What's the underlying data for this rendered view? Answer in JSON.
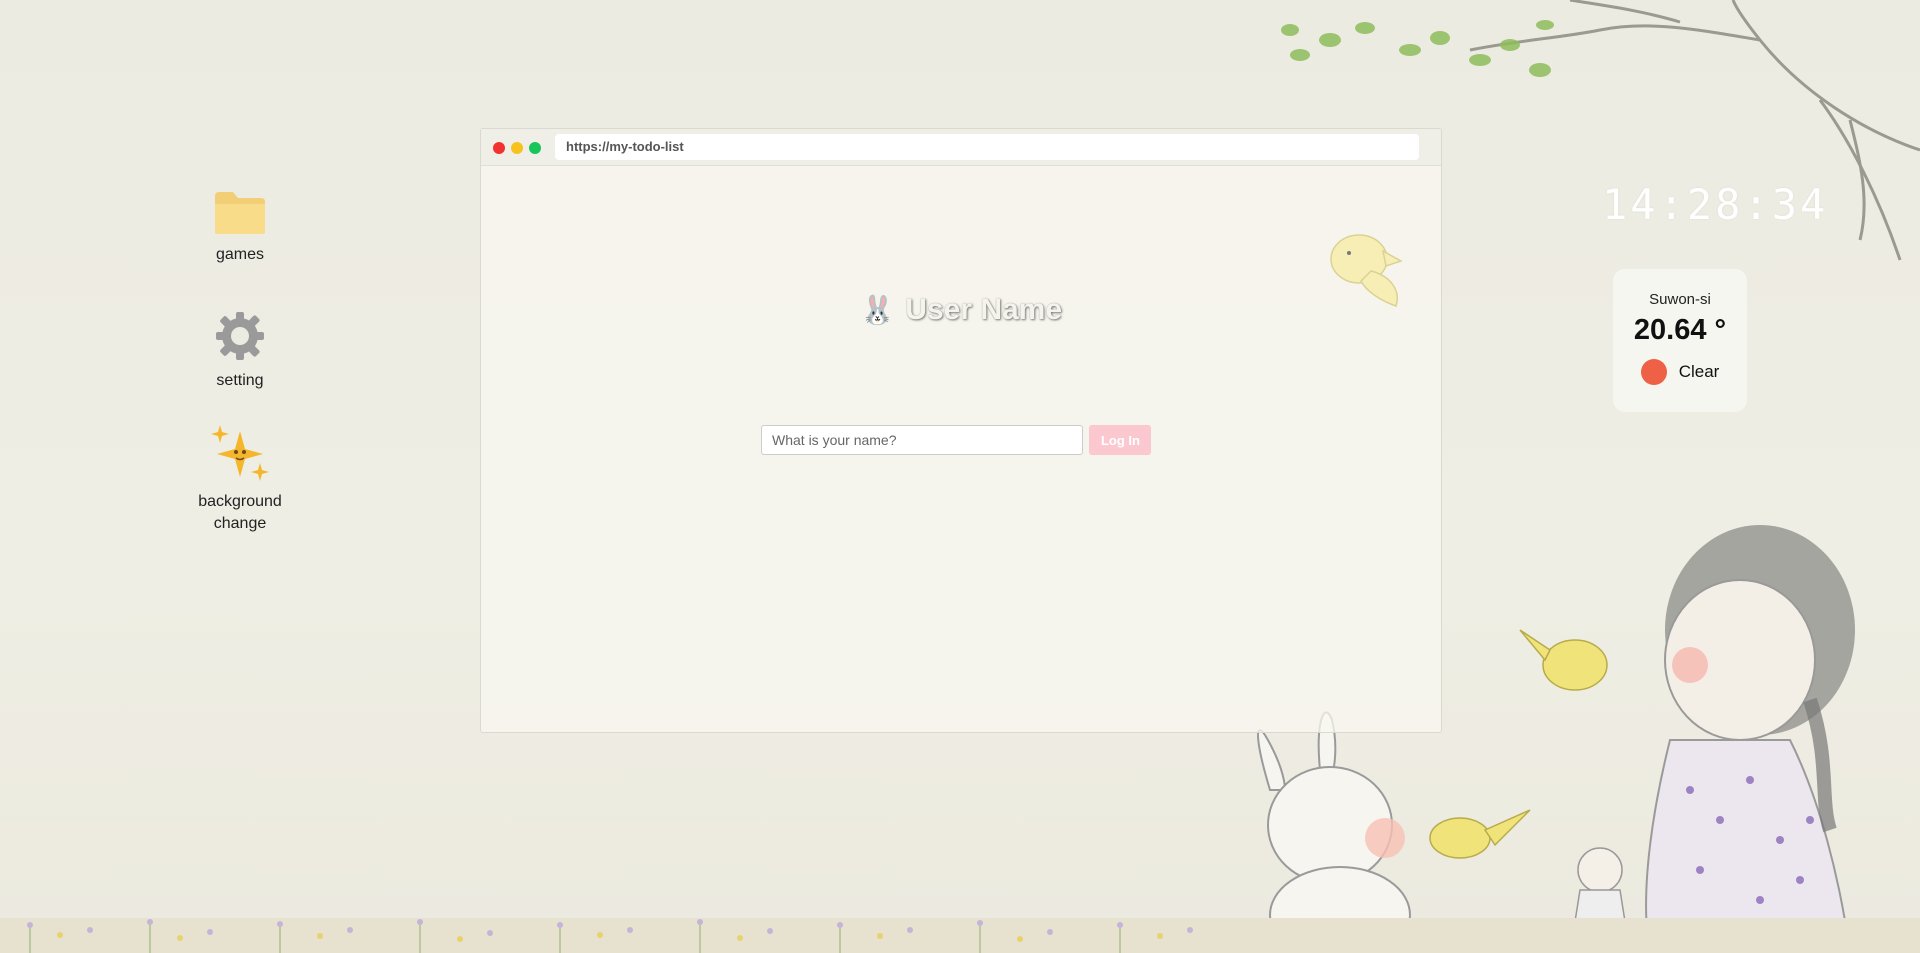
{
  "desktop": {
    "icons": [
      {
        "label": "games",
        "icon": "folder-icon"
      },
      {
        "label": "setting",
        "icon": "gear-icon"
      },
      {
        "label": "background change",
        "icon": "sparkles-icon"
      }
    ]
  },
  "browser": {
    "url": "https://my-todo-list",
    "title": "User Name",
    "title_icon": "🐰",
    "input_placeholder": "What is your name?",
    "login_label": "Log In"
  },
  "clock": {
    "time": "14:28:34"
  },
  "weather": {
    "city": "Suwon-si",
    "temperature": "20.64 °",
    "condition": "Clear",
    "condition_color": "#ee6146"
  },
  "colors": {
    "accent_pink": "#fcc8d0",
    "dot_red": "#f1322f",
    "dot_yellow": "#f8c21c",
    "dot_green": "#19c45b"
  }
}
